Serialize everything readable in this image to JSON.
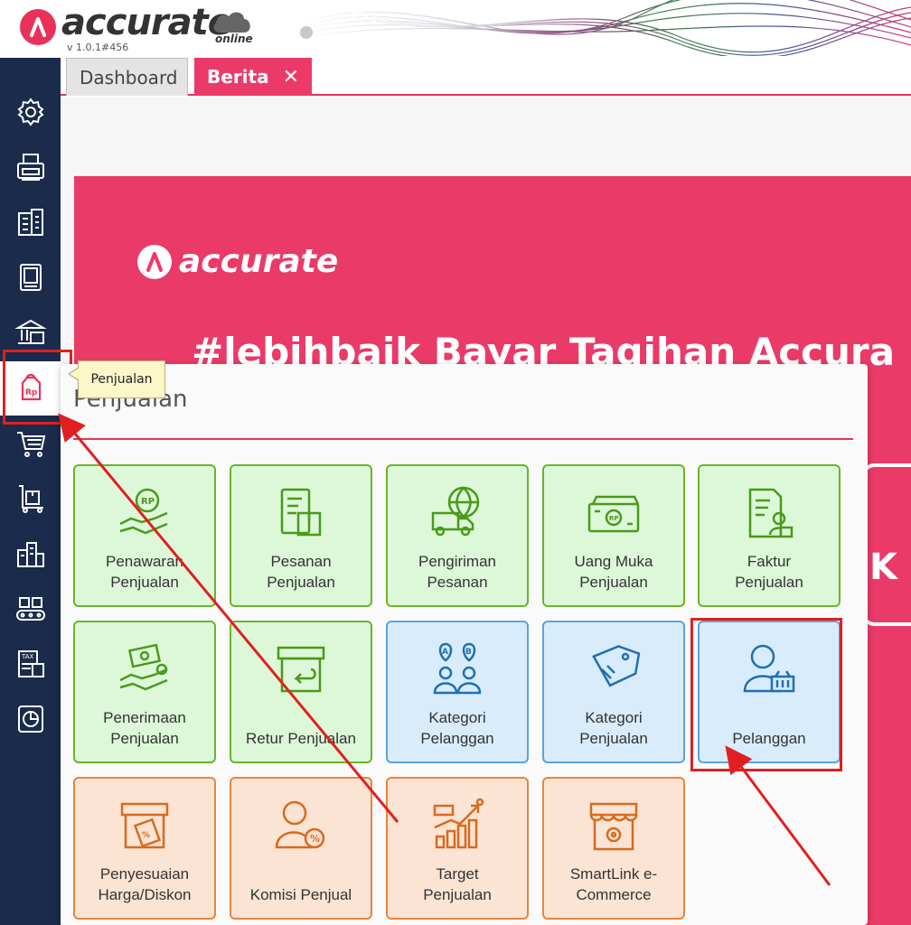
{
  "header": {
    "brand": "accurate",
    "cloud_label": "online",
    "version": "v 1.0.1#456"
  },
  "tabs": [
    {
      "label": "Dashboard",
      "active": false
    },
    {
      "label": "Berita",
      "active": true,
      "close": "✕"
    }
  ],
  "banner": {
    "logo_text": "accurate",
    "headline": "#lebihbaik Bayar Tagihan Accura",
    "partial_text": "K"
  },
  "sidebar": {
    "items": [
      {
        "name": "settings",
        "icon": "gear-icon"
      },
      {
        "name": "fax",
        "icon": "fax-icon"
      },
      {
        "name": "company",
        "icon": "building-icon"
      },
      {
        "name": "ledger",
        "icon": "book-icon"
      },
      {
        "name": "bank",
        "icon": "bank-icon"
      },
      {
        "name": "penjualan",
        "icon": "sales-tag-icon",
        "active": true
      },
      {
        "name": "pembelian",
        "icon": "cart-icon"
      },
      {
        "name": "persediaan",
        "icon": "hand-truck-icon"
      },
      {
        "name": "aset",
        "icon": "city-icon"
      },
      {
        "name": "produksi",
        "icon": "conveyor-icon"
      },
      {
        "name": "pajak",
        "icon": "tax-icon"
      },
      {
        "name": "laporan",
        "icon": "report-icon"
      }
    ]
  },
  "tooltip": {
    "text": "Penjualan"
  },
  "panel": {
    "title": "Penjualan",
    "tiles": [
      {
        "label1": "Penawaran",
        "label2": "Penjualan",
        "color": "green",
        "icon": "quotation-icon"
      },
      {
        "label1": "Pesanan",
        "label2": "Penjualan",
        "color": "green",
        "icon": "sales-order-icon"
      },
      {
        "label1": "Pengiriman",
        "label2": "Pesanan",
        "color": "green",
        "icon": "delivery-icon"
      },
      {
        "label1": "Uang Muka",
        "label2": "Penjualan",
        "color": "green",
        "icon": "money-icon"
      },
      {
        "label1": "Faktur",
        "label2": "Penjualan",
        "color": "green",
        "icon": "invoice-icon"
      },
      {
        "label1": "Penerimaan",
        "label2": "Penjualan",
        "color": "green",
        "icon": "receipt-icon"
      },
      {
        "label1": "",
        "label2": "Retur Penjualan",
        "color": "green",
        "icon": "return-icon"
      },
      {
        "label1": "Kategori",
        "label2": "Pelanggan",
        "color": "blue",
        "icon": "customer-category-icon"
      },
      {
        "label1": "Kategori",
        "label2": "Penjualan",
        "color": "blue",
        "icon": "tag-icon"
      },
      {
        "label1": "",
        "label2": "Pelanggan",
        "color": "blue",
        "icon": "customer-icon"
      },
      {
        "label1": "Penyesuaian",
        "label2": "Harga/Diskon",
        "color": "orange",
        "icon": "discount-box-icon"
      },
      {
        "label1": "",
        "label2": "Komisi Penjual",
        "color": "orange",
        "icon": "commission-icon"
      },
      {
        "label1": "Target",
        "label2": "Penjualan",
        "color": "orange",
        "icon": "target-chart-icon"
      },
      {
        "label1": "SmartLink e-",
        "label2": "Commerce",
        "color": "orange",
        "icon": "store-icon"
      }
    ]
  },
  "colors": {
    "brand": "#e8325a",
    "sidebar": "#1a2b4c",
    "annotation": "#e02020",
    "green_icon": "#4a9a1a",
    "blue_icon": "#1f6fb2",
    "orange_icon": "#d86a1e"
  }
}
